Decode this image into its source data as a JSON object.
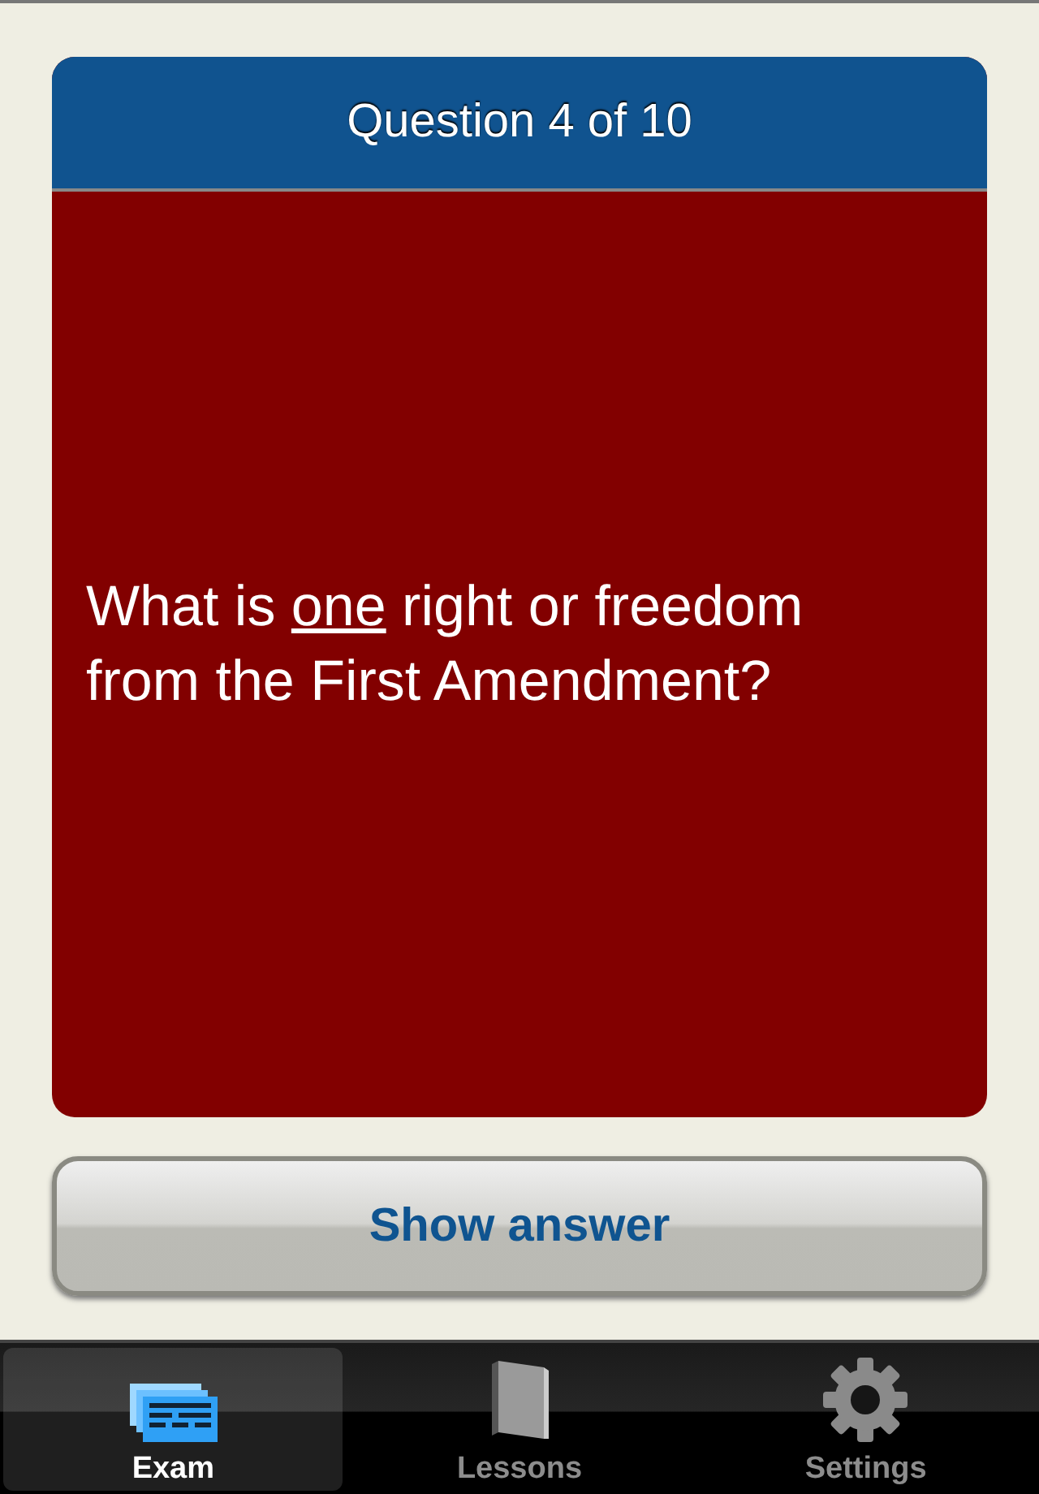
{
  "card": {
    "header": "Question 4 of 10",
    "question": [
      {
        "text": "What is ",
        "underline": false
      },
      {
        "text": "one",
        "underline": true
      },
      {
        "text": " right or freedom from the First Amendment?",
        "underline": false
      }
    ]
  },
  "action_button": "Show answer",
  "tabs": [
    {
      "label": "Exam",
      "kind": "cards",
      "selected": true
    },
    {
      "label": "Lessons",
      "kind": "book",
      "selected": false
    },
    {
      "label": "Settings",
      "kind": "gear",
      "selected": false
    }
  ]
}
